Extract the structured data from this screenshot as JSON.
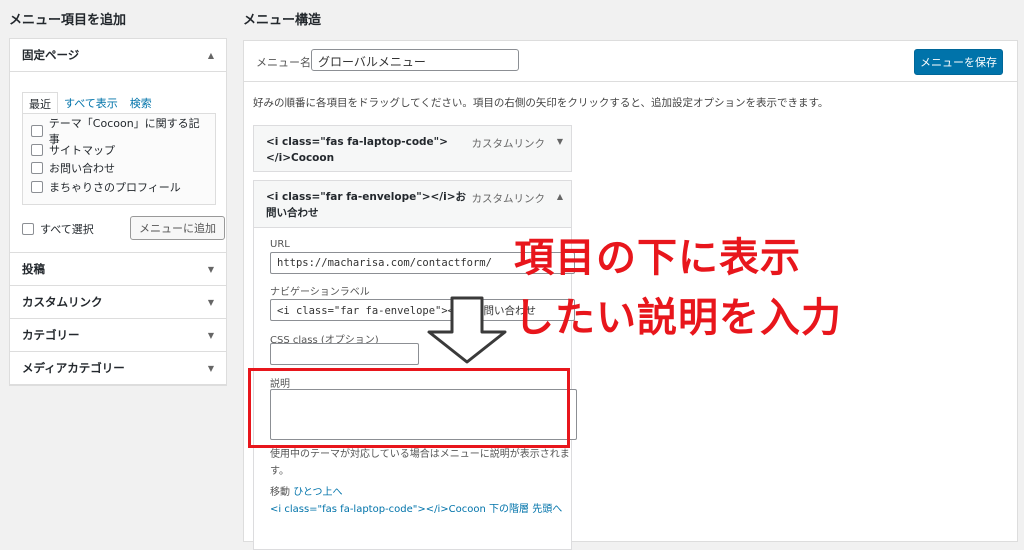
{
  "left": {
    "heading": "メニュー項目を追加",
    "fixed_pages": {
      "title": "固定ページ",
      "tabs": [
        "最近",
        "すべて表示",
        "検索"
      ],
      "items": [
        "テーマ「Cocoon」に関する記事",
        "サイトマップ",
        "お問い合わせ",
        "まちゃりさのプロフィール"
      ],
      "select_all": "すべて選択",
      "add_button": "メニューに追加"
    },
    "sections": [
      "投稿",
      "カスタムリンク",
      "カテゴリー",
      "メディアカテゴリー"
    ]
  },
  "right": {
    "heading": "メニュー構造",
    "menu_name_label": "メニュー名",
    "menu_name_value": "グローバルメニュー",
    "save_button": "メニューを保存",
    "instructions": "好みの順番に各項目をドラッグしてください。項目の右側の矢印をクリックすると、追加設定オプションを表示できます。",
    "item1": {
      "title_line1": "<i class=\"fas fa-laptop-code\">",
      "title_line2": "</i>Cocoon",
      "type": "カスタムリンク"
    },
    "item2": {
      "title_line1": "<i class=\"far fa-envelope\"></i>お",
      "title_line2": "問い合わせ",
      "type": "カスタムリンク",
      "url_label": "URL",
      "url_value": "https://macharisa.com/contactform/",
      "nav_label": "ナビゲーションラベル",
      "nav_value": "<i class=\"far fa-envelope\"></i>お問い合わせ",
      "css_label": "CSS class (オプション)",
      "desc_label": "説明",
      "note_line1": "使用中のテーマが対応している場合はメニューに説明が表示されま",
      "note_line2": "す。",
      "move_label": "移動",
      "move_up": "ひとつ上へ",
      "move_under": "<i class=\"fas fa-laptop-code\"></i>Cocoon 下の階層",
      "move_top": "先頭へ"
    }
  },
  "annotation": {
    "line1": "項目の下に表示",
    "line2": "したい説明を入力",
    "color": "#e8161c"
  }
}
